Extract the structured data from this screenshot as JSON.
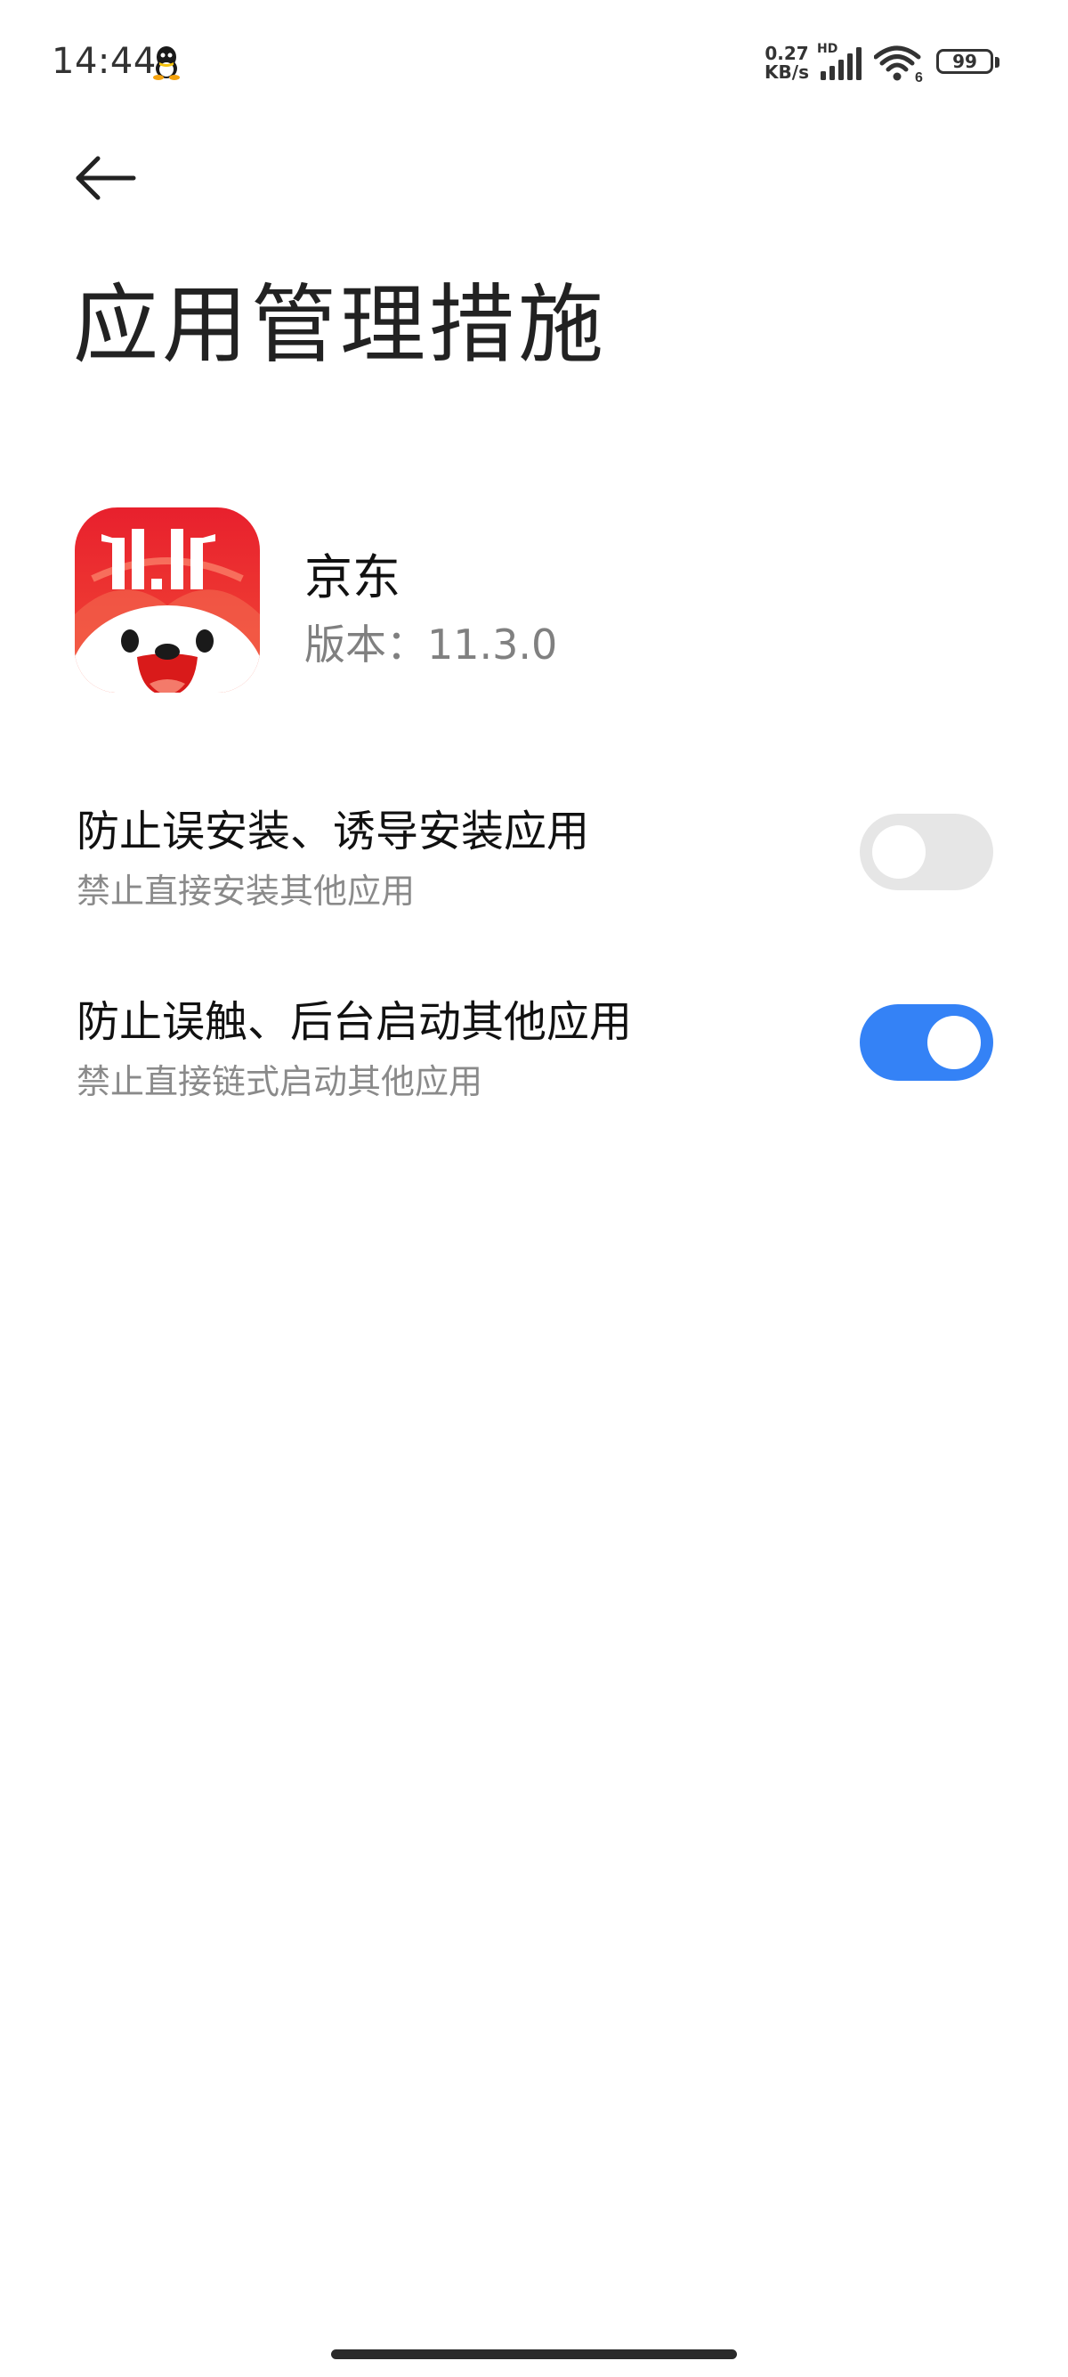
{
  "status_bar": {
    "time": "14:44",
    "net_speed_value": "0.27",
    "net_speed_unit": "KB/s",
    "hd_label": "HD",
    "wifi_badge": "6",
    "battery": "99",
    "notification_icon": "qq-icon",
    "signal_icon": "cellular-signal-icon",
    "wifi_icon": "wifi-icon"
  },
  "header": {
    "back_icon": "back-arrow-icon",
    "title": "应用管理措施"
  },
  "app": {
    "name": "京东",
    "version": "版本：11.3.0",
    "icon_text": "11.11",
    "icon_colors": {
      "bg_top": "#e8202d",
      "bg_bottom": "#f24a36",
      "mascot": "#ffffff",
      "mouth": "#d91a1a"
    }
  },
  "settings": [
    {
      "title": "防止误安装、诱导安装应用",
      "subtitle": "禁止直接安装其他应用",
      "enabled": false
    },
    {
      "title": "防止误触、后台启动其他应用",
      "subtitle": "禁止直接链式启动其他应用",
      "enabled": true
    }
  ],
  "colors": {
    "toggle_on": "#3482f6",
    "toggle_off": "#e6e6e6",
    "secondary_text": "#8a8a8a"
  }
}
